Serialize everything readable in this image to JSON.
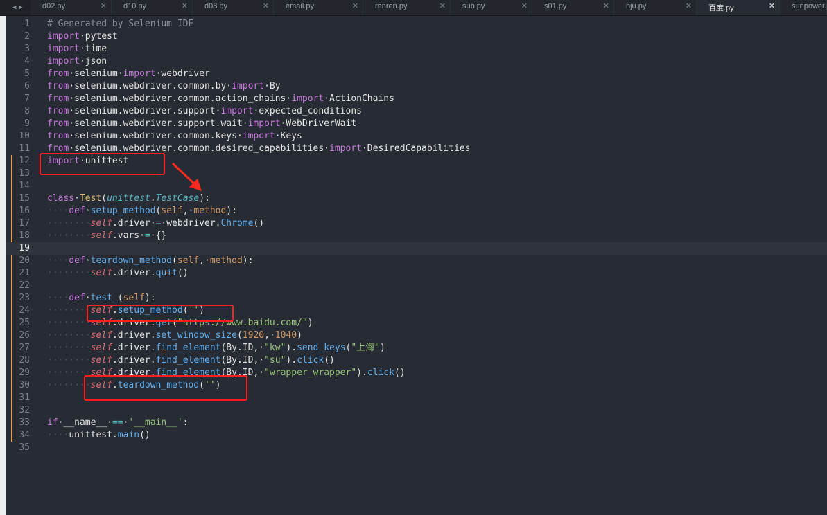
{
  "tabs": [
    {
      "label": "d02.py",
      "active": false
    },
    {
      "label": "d10.py",
      "active": false
    },
    {
      "label": "d08.py",
      "active": false
    },
    {
      "label": "email.py",
      "active": false
    },
    {
      "label": "renren.py",
      "active": false
    },
    {
      "label": "sub.py",
      "active": false
    },
    {
      "label": "s01.py",
      "active": false
    },
    {
      "label": "nju.py",
      "active": false
    },
    {
      "label": "百度.py",
      "active": true
    },
    {
      "label": "sunpower.py",
      "active": false
    }
  ],
  "current_line": 19,
  "modified_ranges": [
    [
      12,
      34
    ]
  ],
  "lines": [
    {
      "n": "1",
      "tokens": [
        [
          "cm",
          "# Generated by Selenium IDE"
        ]
      ]
    },
    {
      "n": "2",
      "tokens": [
        [
          "kw",
          "import"
        ],
        [
          "",
          "·pytest"
        ]
      ]
    },
    {
      "n": "3",
      "tokens": [
        [
          "kw",
          "import"
        ],
        [
          "",
          "·time"
        ]
      ]
    },
    {
      "n": "4",
      "tokens": [
        [
          "kw",
          "import"
        ],
        [
          "",
          "·json"
        ]
      ]
    },
    {
      "n": "5",
      "tokens": [
        [
          "kw",
          "from"
        ],
        [
          "",
          "·selenium·"
        ],
        [
          "kw",
          "import"
        ],
        [
          "",
          "·webdriver"
        ]
      ]
    },
    {
      "n": "6",
      "tokens": [
        [
          "kw",
          "from"
        ],
        [
          "",
          "·selenium.webdriver.common.by·"
        ],
        [
          "kw",
          "import"
        ],
        [
          "",
          "·By"
        ]
      ]
    },
    {
      "n": "7",
      "tokens": [
        [
          "kw",
          "from"
        ],
        [
          "",
          "·selenium.webdriver.common.action_chains·"
        ],
        [
          "kw",
          "import"
        ],
        [
          "",
          "·ActionChains"
        ]
      ]
    },
    {
      "n": "8",
      "tokens": [
        [
          "kw",
          "from"
        ],
        [
          "",
          "·selenium.webdriver.support·"
        ],
        [
          "kw",
          "import"
        ],
        [
          "",
          "·expected_conditions"
        ]
      ]
    },
    {
      "n": "9",
      "tokens": [
        [
          "kw",
          "from"
        ],
        [
          "",
          "·selenium.webdriver.support.wait·"
        ],
        [
          "kw",
          "import"
        ],
        [
          "",
          "·WebDriverWait"
        ]
      ]
    },
    {
      "n": "10",
      "tokens": [
        [
          "kw",
          "from"
        ],
        [
          "",
          "·selenium.webdriver.common.keys·"
        ],
        [
          "kw",
          "import"
        ],
        [
          "",
          "·Keys"
        ]
      ]
    },
    {
      "n": "11",
      "tokens": [
        [
          "kw",
          "from"
        ],
        [
          "",
          "·selenium.webdriver.common.desired_capabilities·"
        ],
        [
          "kw",
          "import"
        ],
        [
          "",
          "·DesiredCapabilities"
        ]
      ]
    },
    {
      "n": "12",
      "tokens": [
        [
          "kw",
          "import"
        ],
        [
          "",
          "·unittest"
        ]
      ]
    },
    {
      "n": "13",
      "tokens": []
    },
    {
      "n": "14",
      "tokens": []
    },
    {
      "n": "15",
      "tokens": [
        [
          "kw",
          "class"
        ],
        [
          "",
          "·"
        ],
        [
          "cls",
          "Test"
        ],
        [
          "",
          "("
        ],
        [
          "it",
          "unittest"
        ],
        [
          "",
          "."
        ],
        [
          "it",
          "TestCase"
        ],
        [
          "",
          "):"
        ]
      ]
    },
    {
      "n": "16",
      "tokens": [
        [
          "dot",
          "····"
        ],
        [
          "kw",
          "def"
        ],
        [
          "",
          "·"
        ],
        [
          "fn",
          "setup_method"
        ],
        [
          "",
          "("
        ],
        [
          "prm",
          "self"
        ],
        [
          "",
          ",·"
        ],
        [
          "prm",
          "method"
        ],
        [
          "",
          "):"
        ]
      ]
    },
    {
      "n": "17",
      "tokens": [
        [
          "dot",
          "········"
        ],
        [
          "slf",
          "self"
        ],
        [
          "",
          ".driver·"
        ],
        [
          "op",
          "="
        ],
        [
          "",
          "·webdriver."
        ],
        [
          "fn",
          "Chrome"
        ],
        [
          "",
          "()"
        ]
      ]
    },
    {
      "n": "18",
      "tokens": [
        [
          "dot",
          "········"
        ],
        [
          "slf",
          "self"
        ],
        [
          "",
          ".vars·"
        ],
        [
          "op",
          "="
        ],
        [
          "",
          "·{}"
        ]
      ]
    },
    {
      "n": "19",
      "tokens": []
    },
    {
      "n": "20",
      "tokens": [
        [
          "dot",
          "····"
        ],
        [
          "kw",
          "def"
        ],
        [
          "",
          "·"
        ],
        [
          "fn",
          "teardown_method"
        ],
        [
          "",
          "("
        ],
        [
          "prm",
          "self"
        ],
        [
          "",
          ",·"
        ],
        [
          "prm",
          "method"
        ],
        [
          "",
          "):"
        ]
      ]
    },
    {
      "n": "21",
      "tokens": [
        [
          "dot",
          "········"
        ],
        [
          "slf",
          "self"
        ],
        [
          "",
          ".driver."
        ],
        [
          "fn",
          "quit"
        ],
        [
          "",
          "()"
        ]
      ]
    },
    {
      "n": "22",
      "tokens": []
    },
    {
      "n": "23",
      "tokens": [
        [
          "dot",
          "····"
        ],
        [
          "kw",
          "def"
        ],
        [
          "",
          "·"
        ],
        [
          "fn",
          "test_"
        ],
        [
          "",
          "("
        ],
        [
          "prm",
          "self"
        ],
        [
          "",
          "):"
        ]
      ]
    },
    {
      "n": "24",
      "tokens": [
        [
          "dot",
          "········"
        ],
        [
          "slf",
          "self"
        ],
        [
          "",
          "."
        ],
        [
          "fn",
          "setup_method"
        ],
        [
          "",
          "("
        ],
        [
          "str",
          "''"
        ],
        [
          "",
          ")"
        ]
      ]
    },
    {
      "n": "25",
      "tokens": [
        [
          "dot",
          "········"
        ],
        [
          "slf",
          "self"
        ],
        [
          "",
          ".driver."
        ],
        [
          "fn",
          "get"
        ],
        [
          "",
          "("
        ],
        [
          "str",
          "\"https://www.baidu.com/\""
        ],
        [
          "",
          ")"
        ]
      ]
    },
    {
      "n": "26",
      "tokens": [
        [
          "dot",
          "········"
        ],
        [
          "slf",
          "self"
        ],
        [
          "",
          ".driver."
        ],
        [
          "fn",
          "set_window_size"
        ],
        [
          "",
          "("
        ],
        [
          "num",
          "1920"
        ],
        [
          "",
          ",·"
        ],
        [
          "num",
          "1040"
        ],
        [
          "",
          ")"
        ]
      ]
    },
    {
      "n": "27",
      "tokens": [
        [
          "dot",
          "········"
        ],
        [
          "slf",
          "self"
        ],
        [
          "",
          ".driver."
        ],
        [
          "fn",
          "find_element"
        ],
        [
          "",
          "(By.ID,·"
        ],
        [
          "str",
          "\"kw\""
        ],
        [
          "",
          ")."
        ],
        [
          "fn",
          "send_keys"
        ],
        [
          "",
          "("
        ],
        [
          "str",
          "\"上海\""
        ],
        [
          "",
          ")"
        ]
      ]
    },
    {
      "n": "28",
      "tokens": [
        [
          "dot",
          "········"
        ],
        [
          "slf",
          "self"
        ],
        [
          "",
          ".driver."
        ],
        [
          "fn",
          "find_element"
        ],
        [
          "",
          "(By.ID,·"
        ],
        [
          "str",
          "\"su\""
        ],
        [
          "",
          ")."
        ],
        [
          "fn",
          "click"
        ],
        [
          "",
          "()"
        ]
      ]
    },
    {
      "n": "29",
      "tokens": [
        [
          "dot",
          "········"
        ],
        [
          "slf",
          "self"
        ],
        [
          "",
          ".driver."
        ],
        [
          "fn",
          "find_element"
        ],
        [
          "",
          "(By.ID,·"
        ],
        [
          "str",
          "\"wrapper_wrapper\""
        ],
        [
          "",
          ")."
        ],
        [
          "fn",
          "click"
        ],
        [
          "",
          "()"
        ]
      ]
    },
    {
      "n": "30",
      "tokens": [
        [
          "dot",
          "········"
        ],
        [
          "slf",
          "self"
        ],
        [
          "",
          "."
        ],
        [
          "fn",
          "teardown_method"
        ],
        [
          "",
          "("
        ],
        [
          "str",
          "''"
        ],
        [
          "",
          ")"
        ]
      ]
    },
    {
      "n": "31",
      "tokens": []
    },
    {
      "n": "32",
      "tokens": []
    },
    {
      "n": "33",
      "tokens": [
        [
          "kw",
          "if"
        ],
        [
          "",
          "·__name__·"
        ],
        [
          "op",
          "=="
        ],
        [
          "",
          "·"
        ],
        [
          "str",
          "'__main__'"
        ],
        [
          "",
          ":"
        ]
      ]
    },
    {
      "n": "34",
      "tokens": [
        [
          "dot",
          "····"
        ],
        [
          "",
          "unittest."
        ],
        [
          "fn",
          "main"
        ],
        [
          "",
          "()"
        ]
      ]
    },
    {
      "n": "35",
      "tokens": []
    }
  ],
  "annotations": {
    "boxes": [
      {
        "label": "highlight-import-unittest"
      },
      {
        "label": "highlight-setup-call"
      },
      {
        "label": "highlight-teardown-call"
      }
    ],
    "arrow_color": "#ff2a1f"
  }
}
